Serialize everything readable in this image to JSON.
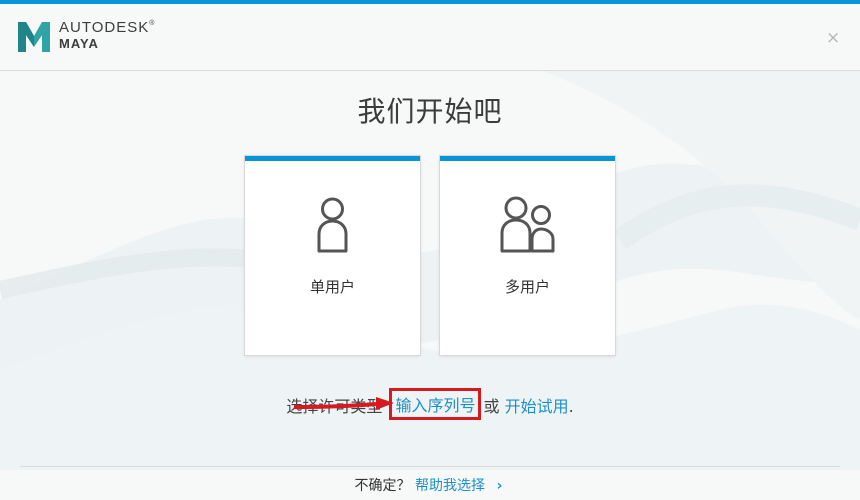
{
  "header": {
    "company": "AUTODESK",
    "trademark": "®",
    "product": "MAYA",
    "close_symbol": "×"
  },
  "title": "我们开始吧",
  "cards": [
    {
      "label": "单用户",
      "icon": "single-user-icon"
    },
    {
      "label": "多用户",
      "icon": "multi-user-icon"
    }
  ],
  "license": {
    "prompt": "选择许可类型",
    "serial_link": "输入序列号",
    "conjunction": "或",
    "trial_link": "开始试用",
    "period": "."
  },
  "footer": {
    "question": "不确定？",
    "help_link": "帮助我选择",
    "chevron": "›"
  },
  "colors": {
    "accent": "#0696d7",
    "link": "#1f8fc7",
    "highlight": "#d71920",
    "logo": "#2fa3a6"
  }
}
